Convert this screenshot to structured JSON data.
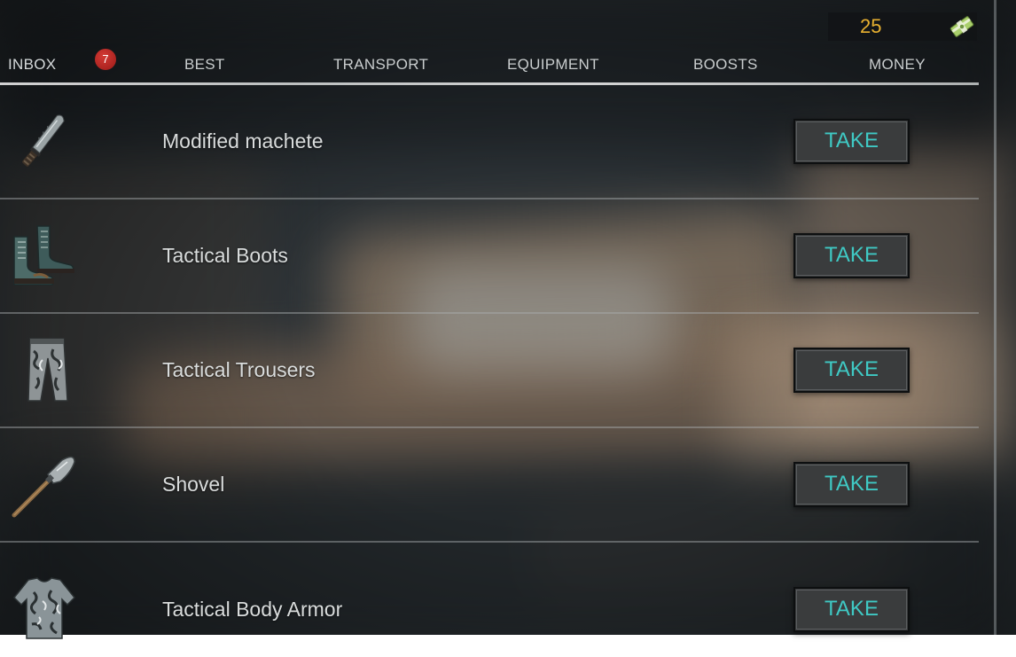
{
  "currency": {
    "amount": "25",
    "icon": "cash-bundle-icon",
    "color": "#e8b030"
  },
  "tabs": [
    {
      "label": "INBOX",
      "badge": "7"
    },
    {
      "label": "BEST"
    },
    {
      "label": "TRANSPORT"
    },
    {
      "label": "EQUIPMENT"
    },
    {
      "label": "BOOSTS"
    },
    {
      "label": "MONEY"
    }
  ],
  "items": [
    {
      "name": "Modified machete",
      "icon": "machete-icon",
      "action": "TAKE"
    },
    {
      "name": "Tactical Boots",
      "icon": "boots-icon",
      "action": "TAKE"
    },
    {
      "name": "Tactical Trousers",
      "icon": "trousers-icon",
      "action": "TAKE"
    },
    {
      "name": "Shovel",
      "icon": "shovel-icon",
      "action": "TAKE"
    },
    {
      "name": "Tactical Body Armor",
      "icon": "body-armor-icon",
      "action": "TAKE"
    }
  ],
  "colors": {
    "accent": "#3fc9c4",
    "badge": "#c0302c",
    "button_bg": "#3a3c3d"
  }
}
